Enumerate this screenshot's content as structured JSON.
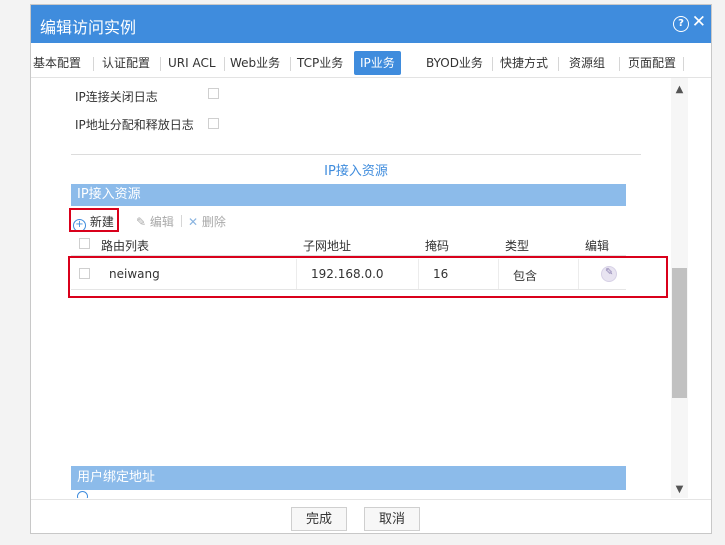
{
  "dialog": {
    "title": "编辑访问实例"
  },
  "tabs": [
    {
      "label": "基本配置"
    },
    {
      "label": "认证配置"
    },
    {
      "label": "URI ACL"
    },
    {
      "label": "Web业务"
    },
    {
      "label": "TCP业务"
    },
    {
      "label": "IP业务",
      "active": true
    },
    {
      "label": "BYOD业务"
    },
    {
      "label": "快捷方式"
    },
    {
      "label": "资源组"
    },
    {
      "label": "页面配置"
    }
  ],
  "logs": {
    "ip_close_log": "IP连接关闭日志",
    "ip_alloc_log": "IP地址分配和释放日志"
  },
  "ip_access": {
    "section_title": "IP接入资源",
    "panel_title": "IP接入资源",
    "toolbar": {
      "new": "新建",
      "edit": "编辑",
      "delete": "删除"
    },
    "columns": [
      "路由列表",
      "子网地址",
      "掩码",
      "类型",
      "编辑"
    ],
    "rows": [
      {
        "route": "neiwang",
        "subnet": "192.168.0.0",
        "mask": "16",
        "type": "包含"
      }
    ]
  },
  "user_bind": {
    "panel_title": "用户绑定地址"
  },
  "footer": {
    "ok": "完成",
    "cancel": "取消"
  },
  "colors": {
    "accent": "#3f8cdd",
    "highlight": "#d9001b"
  }
}
